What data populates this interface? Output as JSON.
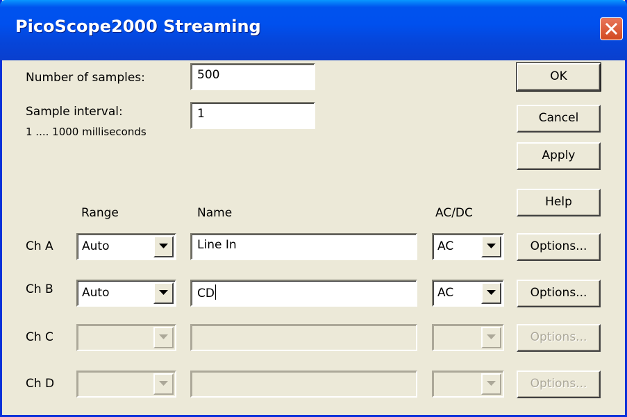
{
  "window": {
    "title": "PicoScope2000 Streaming"
  },
  "fields": {
    "num_samples_label": "Number of samples:",
    "num_samples_value": "500",
    "interval_label": "Sample interval:",
    "interval_hint": "1 .... 1000 milliseconds",
    "interval_value": "1"
  },
  "buttons": {
    "ok": "OK",
    "cancel": "Cancel",
    "apply": "Apply",
    "help": "Help"
  },
  "columns": {
    "range": "Range",
    "name": "Name",
    "acdc": "AC/DC"
  },
  "channels": [
    {
      "label": "Ch A",
      "range": "Auto",
      "name": "Line In",
      "coupling": "AC",
      "options": "Options...",
      "enabled": true
    },
    {
      "label": "Ch B",
      "range": "Auto",
      "name": "CD",
      "coupling": "AC",
      "options": "Options...",
      "enabled": true
    },
    {
      "label": "Ch C",
      "range": "",
      "name": "",
      "coupling": "",
      "options": "Options...",
      "enabled": false
    },
    {
      "label": "Ch D",
      "range": "",
      "name": "",
      "coupling": "",
      "options": "Options...",
      "enabled": false
    }
  ],
  "icons": {
    "close": "close-icon",
    "dropdown": "chevron-down-icon"
  },
  "colors": {
    "titlebar": "#0053ee",
    "close": "#d2491f",
    "face": "#ece9d8"
  }
}
